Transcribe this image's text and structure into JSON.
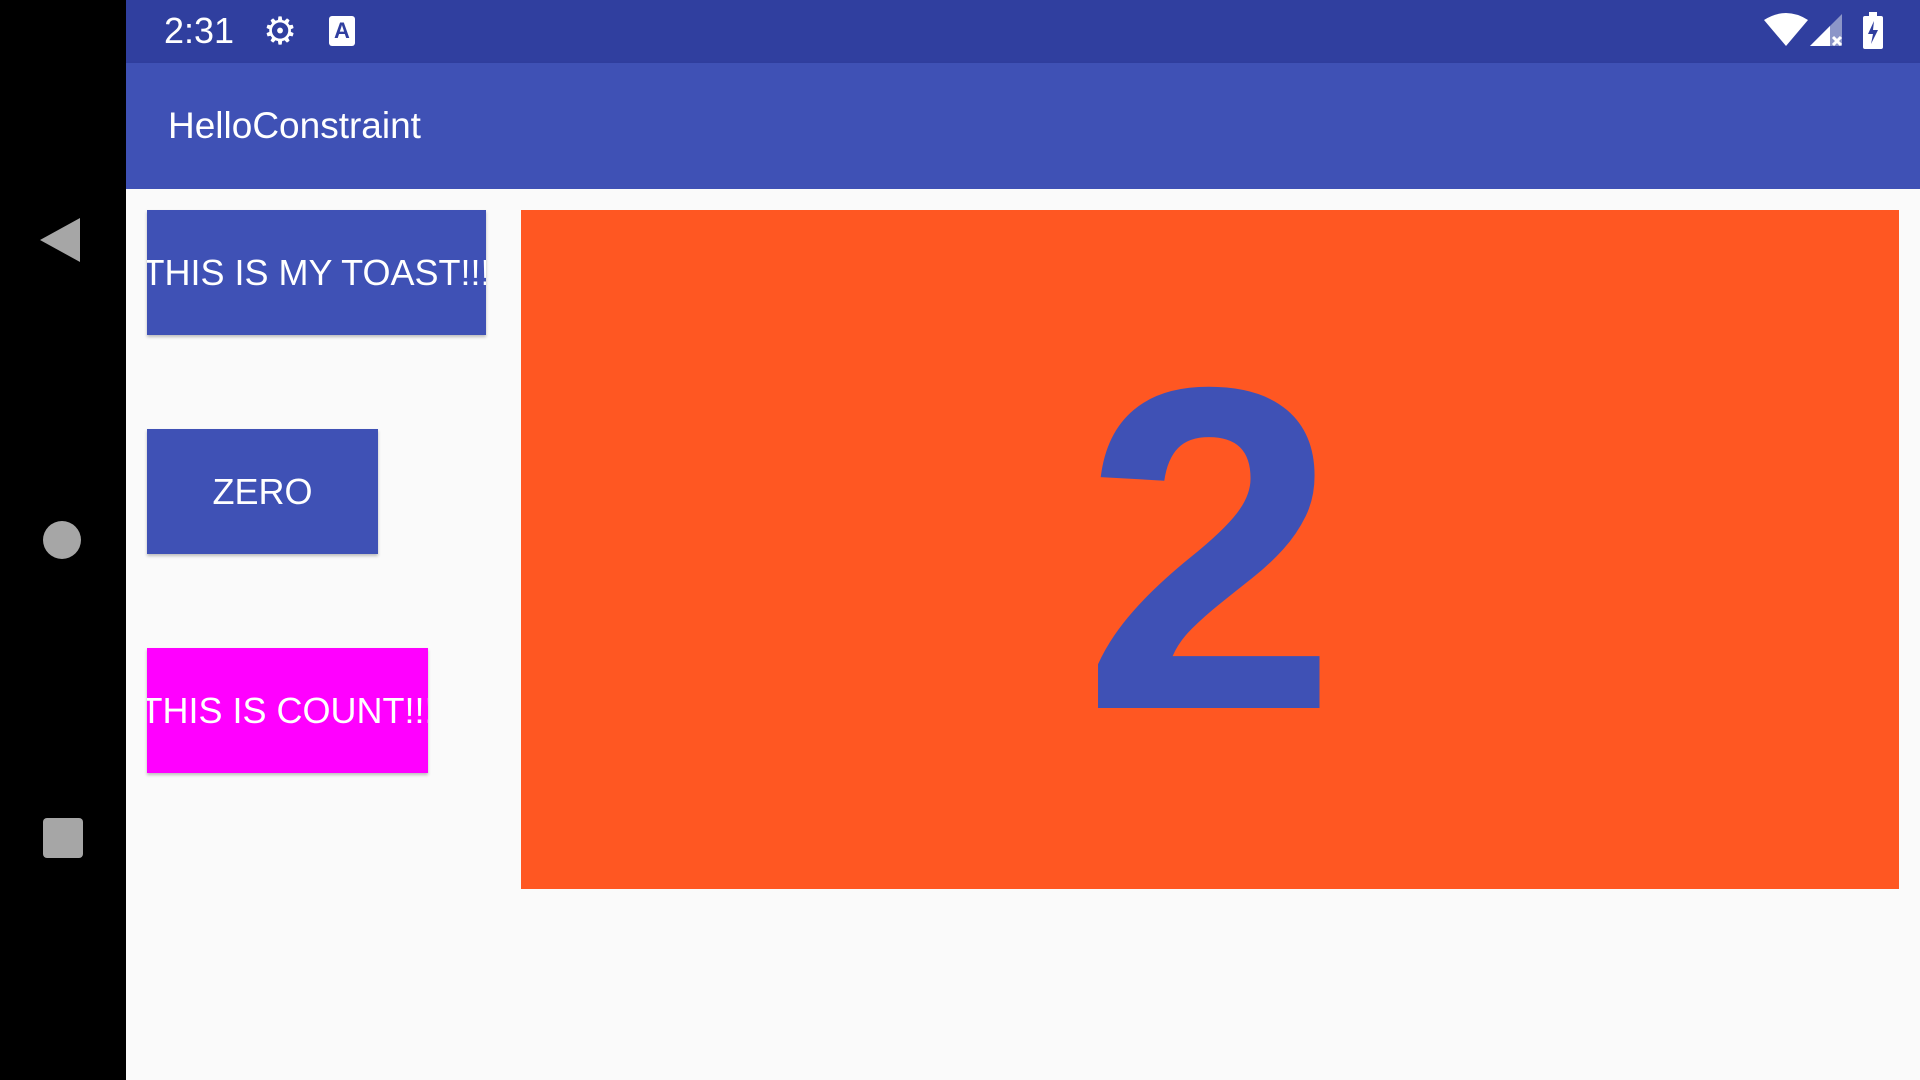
{
  "status_bar": {
    "time": "2:31",
    "settings_icon": "gear-icon",
    "notification_icon": "a-icon",
    "notification_letter": "A",
    "wifi_icon": "wifi-icon",
    "signal_icon": "signal-icon",
    "battery_icon": "battery-icon"
  },
  "app_bar": {
    "title": "HelloConstraint"
  },
  "buttons": {
    "toast_label": "THIS IS MY TOAST!!!",
    "zero_label": "ZERO",
    "count_label": "THIS IS COUNT!!!"
  },
  "counter": {
    "value": "2"
  },
  "colors": {
    "primary": "#3f51b5",
    "primary_dark": "#303f9f",
    "count_background": "#ff5722",
    "count_button": "#ff00ff"
  },
  "navigation": {
    "back_icon": "back-triangle-icon",
    "home_icon": "home-circle-icon",
    "recents_icon": "recents-square-icon"
  }
}
